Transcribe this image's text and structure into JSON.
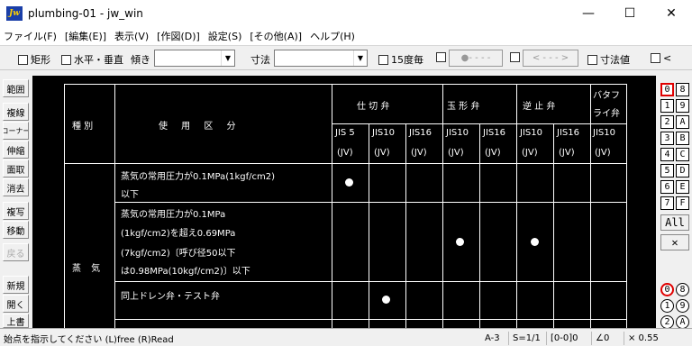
{
  "window": {
    "title": "plumbing-01 - jw_win",
    "icon": "jw-app-icon",
    "min": "—",
    "max": "☐",
    "close": "✕"
  },
  "menu": [
    "ファイル(F)",
    "[編集(E)]",
    "表示(V)",
    "[作図(D)]",
    "設定(S)",
    "[その他(A)]",
    "ヘルプ(H)"
  ],
  "toolbar": {
    "rect": "矩形",
    "hv": "水平・垂直",
    "tilt": "傾き",
    "dim": "寸法",
    "deg15": "15度毎",
    "dimval": "寸法値",
    "lt": "<",
    "line_style_a": "●- - - -",
    "line_style_b": "< - - - >"
  },
  "left_tools": [
    "範囲",
    "複線",
    "コーナー",
    "伸縮",
    "面取",
    "消去",
    "複写",
    "移動",
    "戻る",
    "新規",
    "開く",
    "上書"
  ],
  "layers": [
    "0",
    "8",
    "1",
    "9",
    "2",
    "A",
    "3",
    "B",
    "4",
    "C",
    "5",
    "D",
    "6",
    "E",
    "7",
    "F"
  ],
  "layer_all": "All",
  "layer_x": "✕",
  "groups": [
    "0",
    "8",
    "1",
    "9",
    "2",
    "A"
  ],
  "status": {
    "message": "始点を指示してください (L)free (R)Read",
    "paper": "A-3",
    "scale": "S=1/1",
    "layer": "[0-0]0",
    "angle": "∠0",
    "factor": "× 0.55"
  },
  "table": {
    "head_kind": "種 別",
    "head_use": "使 用 区 分",
    "groups": [
      "仕 切 弁",
      "玉 形 弁",
      "逆 止 弁",
      "バタフライ弁"
    ],
    "std": [
      "JIS 5",
      "JIS10",
      "JIS16",
      "JIS10",
      "JIS16",
      "JIS10",
      "JIS16",
      "JIS10"
    ],
    "jv": "(JV)",
    "kind": "蒸 気",
    "r1": [
      "蒸気の常用圧力が0.1MPa(1kgf/cm2)",
      "以下"
    ],
    "r2": [
      "蒸気の常用圧力が0.1MPa",
      "(1kgf/cm2)を超え0.69MPa",
      "(7kgf/cm2)〔呼び径50以下",
      "は0.98MPa(10kgf/cm2)〕以下"
    ],
    "r3": "同上ドレン弁・テスト弁",
    "mark": "●"
  }
}
